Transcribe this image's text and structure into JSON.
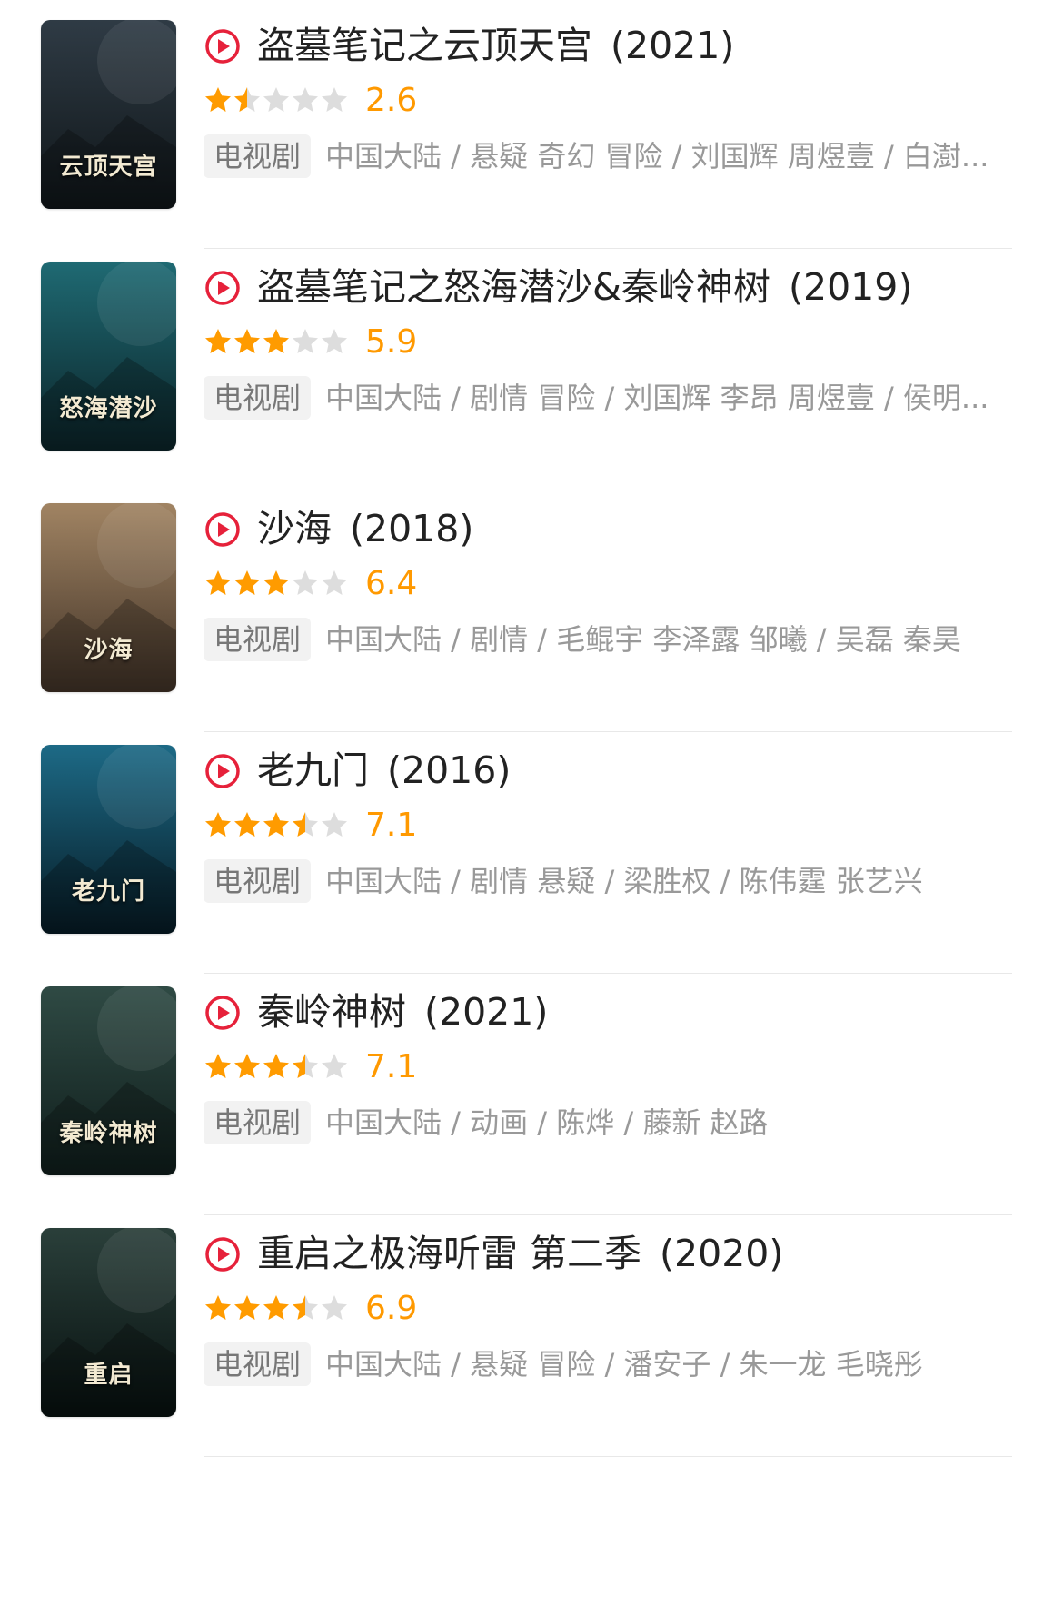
{
  "colors": {
    "accent_red": "#e6213a",
    "score_orange": "#ff9900",
    "star_orange": "#ff9b00",
    "star_gray": "#dddddd",
    "tag_bg": "#f2f2f2"
  },
  "items": [
    {
      "title": "盗墓笔记之云顶天宫",
      "year": "(2021)",
      "rating": 2.6,
      "stars": 1.5,
      "category": "电视剧",
      "meta": "中国大陆 / 悬疑 奇幻 冒险 / 刘国辉 周煜壹 / 白澍...",
      "poster": {
        "colors": [
          "#2f3b45",
          "#0f1518"
        ],
        "text": "云顶天宫"
      }
    },
    {
      "title": "盗墓笔记之怒海潜沙&秦岭神树",
      "year": "(2019)",
      "rating": 5.9,
      "stars": 3,
      "category": "电视剧",
      "meta": "中国大陆 / 剧情 冒险 / 刘国辉 李昂 周煜壹 / 侯明...",
      "poster": {
        "colors": [
          "#1f6a73",
          "#0b2328"
        ],
        "text": "怒海潜沙"
      }
    },
    {
      "title": "沙海",
      "year": "(2018)",
      "rating": 6.4,
      "stars": 3,
      "category": "电视剧",
      "meta": "中国大陆 / 剧情 / 毛鲲宇 李泽露 邹曦 / 吴磊 秦昊",
      "poster": {
        "colors": [
          "#a18463",
          "#3f3126"
        ],
        "text": "沙海"
      }
    },
    {
      "title": "老九门",
      "year": "(2016)",
      "rating": 7.1,
      "stars": 3.5,
      "category": "电视剧",
      "meta": "中国大陆 / 剧情 悬疑 / 梁胜权 / 陈伟霆 张艺兴",
      "poster": {
        "colors": [
          "#1d6a86",
          "#061a24"
        ],
        "text": "老九门"
      }
    },
    {
      "title": "秦岭神树",
      "year": "(2021)",
      "rating": 7.1,
      "stars": 3.5,
      "category": "电视剧",
      "meta": "中国大陆 / 动画 / 陈烨 / 藤新 赵路",
      "poster": {
        "colors": [
          "#2f4a44",
          "#0f1d1b"
        ],
        "text": "秦岭神树"
      }
    },
    {
      "title": "重启之极海听雷 第二季",
      "year": "(2020)",
      "rating": 6.9,
      "stars": 3.5,
      "category": "电视剧",
      "meta": "中国大陆 / 悬疑 冒险 / 潘安子 / 朱一龙 毛晓彤",
      "poster": {
        "colors": [
          "#2a3f3a",
          "#07100f"
        ],
        "text": "重启"
      }
    }
  ]
}
